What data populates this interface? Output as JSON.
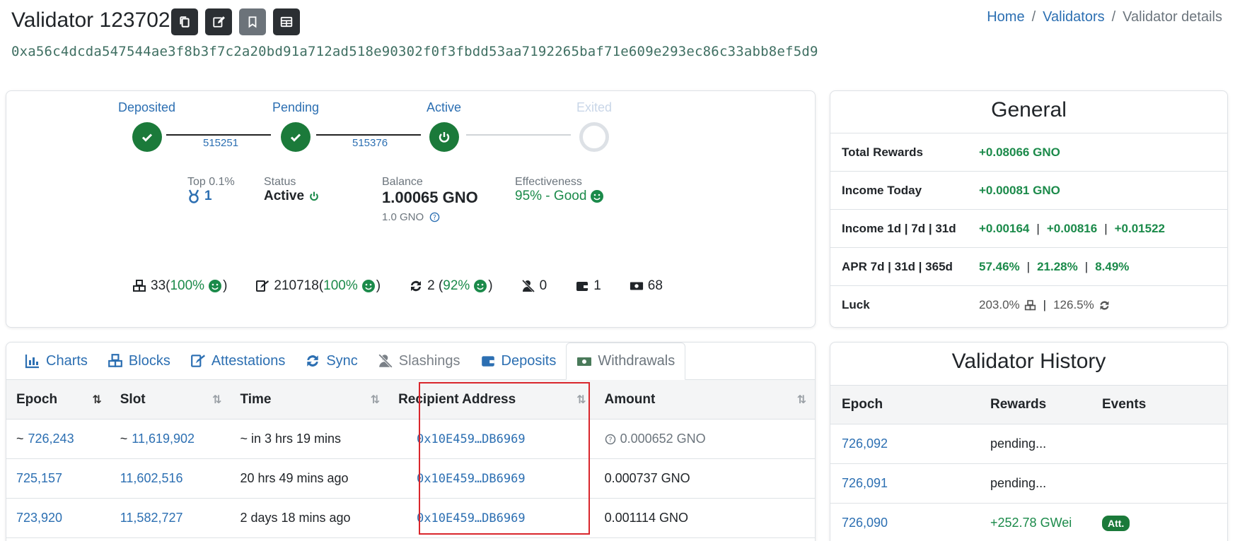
{
  "header": {
    "title": "Validator 123702",
    "pubkey": "0xa56c4dcda547544ae3f8b3f7c2a20bd91a712ad518e90302f0f3fbdd53aa7192265baf71e609e293ec86c33abb8ef5d9",
    "breadcrumb": [
      "Home",
      "Validators",
      "Validator details"
    ],
    "breadcrumb_sep": "/"
  },
  "lifecycle": {
    "steps": [
      "Deposited",
      "Pending",
      "Active",
      "Exited"
    ],
    "epochs": [
      "515251",
      "515376"
    ]
  },
  "stats": {
    "rank_label": "Top 0.1%",
    "rank_value": "1",
    "status_label": "Status",
    "status_value": "Active",
    "balance_label": "Balance",
    "balance_value": "1.00065 GNO",
    "balance_sub": "1.0 GNO",
    "effectiveness_label": "Effectiveness",
    "effectiveness_value": "95% - Good"
  },
  "counters": {
    "blocks": "33",
    "blocks_pct": "100%",
    "attestations": "210718",
    "attestations_pct": "100%",
    "sync": "2",
    "sync_pct": "92%",
    "slashings": "0",
    "deposits": "1",
    "withdrawals": "68",
    "open_paren": "(",
    "open_paren_space": " (",
    "close_paren": ")"
  },
  "general": {
    "title": "General",
    "total_rewards_label": "Total Rewards",
    "total_rewards": "+0.08066 GNO",
    "income_today_label": "Income Today",
    "income_today": "+0.00081 GNO",
    "income_periods_label": "Income 1d | 7d | 31d",
    "income_1d": "+0.00164",
    "income_7d": "+0.00816",
    "income_31d": "+0.01522",
    "apr_label": "APR 7d | 31d | 365d",
    "apr_7d": "57.46%",
    "apr_31d": "21.28%",
    "apr_365d": "8.49%",
    "luck_label": "Luck",
    "luck_blocks": "203.0%",
    "luck_sync": "126.5%",
    "sep": "|"
  },
  "tabs": [
    "Charts",
    "Blocks",
    "Attestations",
    "Sync",
    "Slashings",
    "Deposits",
    "Withdrawals"
  ],
  "withdrawals_table": {
    "columns": [
      "Epoch",
      "Slot",
      "Time",
      "Recipient Address",
      "Amount"
    ],
    "rows": [
      {
        "epoch_prefix": "~",
        "epoch": "726,243",
        "slot_prefix": "~",
        "slot": "11,619,902",
        "time": "~ in 3 hrs 19 mins",
        "address": "0x10E459…DB6969",
        "amount": "0.000652 GNO"
      },
      {
        "epoch_prefix": "",
        "epoch": "725,157",
        "slot_prefix": "",
        "slot": "11,602,516",
        "time": "20 hrs 49 mins ago",
        "address": "0x10E459…DB6969",
        "amount": "0.000737 GNO"
      },
      {
        "epoch_prefix": "",
        "epoch": "723,920",
        "slot_prefix": "",
        "slot": "11,582,727",
        "time": "2 days 18 mins ago",
        "address": "0x10E459…DB6969",
        "amount": "0.001114 GNO"
      }
    ]
  },
  "history": {
    "title": "Validator History",
    "columns": [
      "Epoch",
      "Rewards",
      "Events"
    ],
    "rows": [
      {
        "epoch": "726,092",
        "rewards": "pending...",
        "event": ""
      },
      {
        "epoch": "726,091",
        "rewards": "pending...",
        "event": ""
      },
      {
        "epoch": "726,090",
        "rewards": "+252.78 GWei",
        "event": "Att."
      }
    ]
  },
  "colors": {
    "link": "#2c6fb2",
    "success": "#1b8a4a",
    "highlight_border": "#d9262c",
    "dark_button": "#2b2f33"
  }
}
